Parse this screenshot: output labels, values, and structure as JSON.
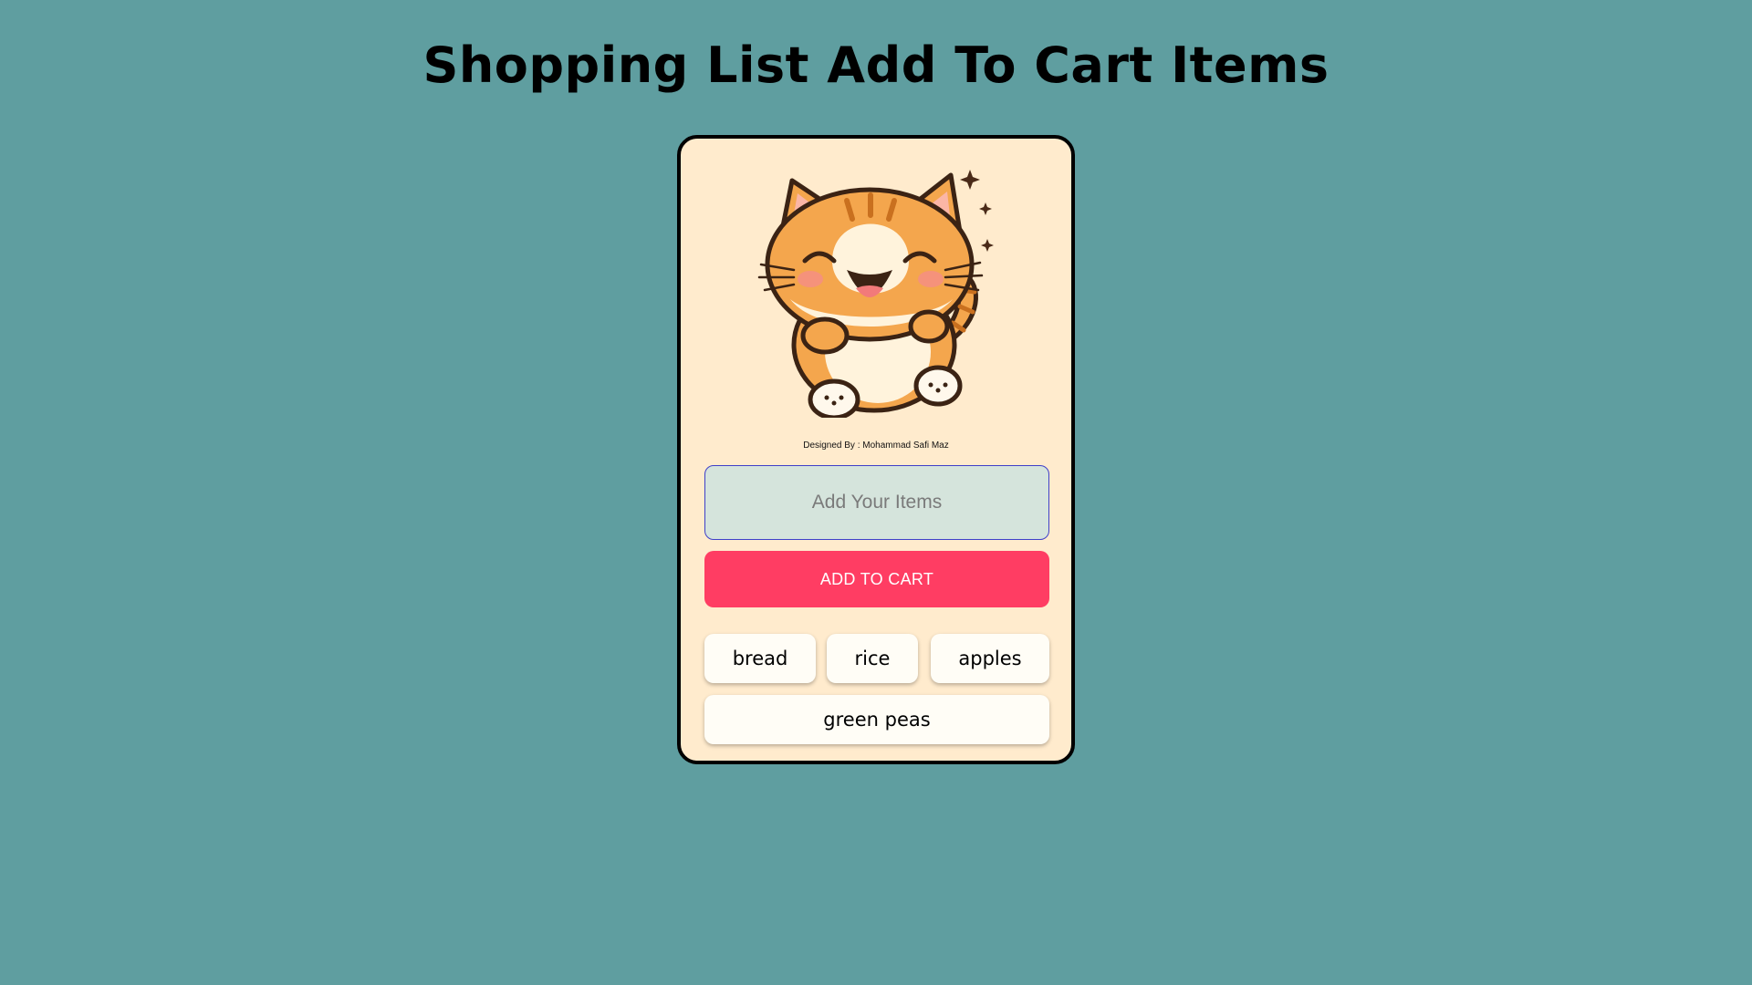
{
  "page": {
    "title": "Shopping List Add To Cart Items"
  },
  "card": {
    "image_name": "happy-cat-illustration",
    "credit": "Designed By : Mohammad Safi Maz",
    "input": {
      "placeholder": "Add Your Items",
      "value": ""
    },
    "add_button_label": "ADD TO CART",
    "items": [
      "bread",
      "rice",
      "apples",
      "green peas"
    ]
  },
  "colors": {
    "background": "#5f9ea0",
    "card": "#ffebcd",
    "button": "#ff3d63",
    "input": "#d5e4dc",
    "chip": "#fffdf6"
  }
}
